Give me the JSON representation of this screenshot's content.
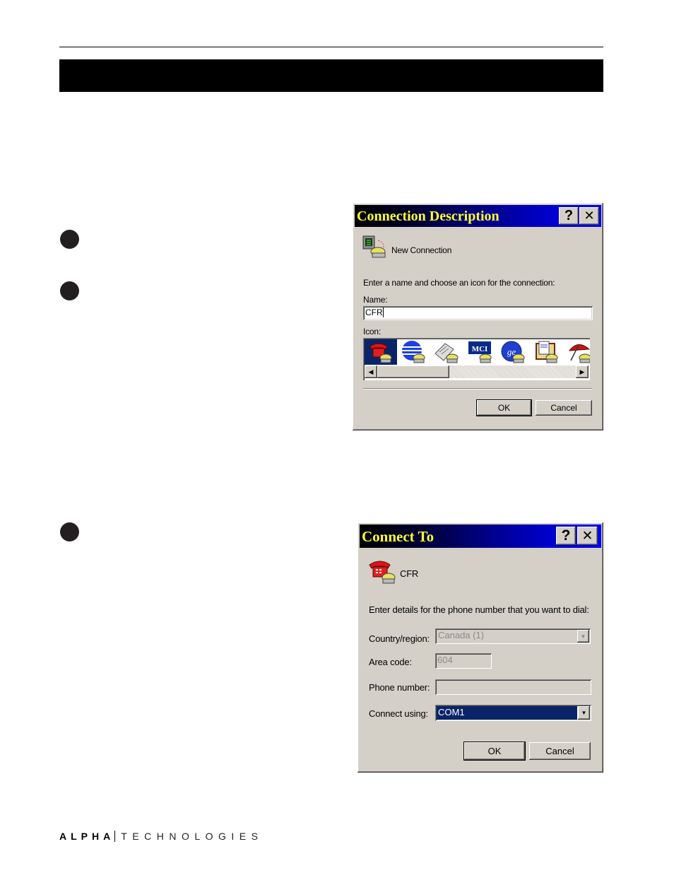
{
  "page": {
    "brand": {
      "alpha": "ALPHA",
      "technologies": "TECHNOLOGIES"
    }
  },
  "dialog1": {
    "title": "Connection Description",
    "help_button": "?",
    "close_button": "✕",
    "header_label": "New Connection",
    "instruction": "Enter a name and choose an icon for the connection:",
    "name_label": "Name:",
    "name_value": "CFR",
    "icon_label": "Icon:",
    "icons": [
      "red-telephone-icon",
      "globe-stripes-icon",
      "newspaper-icon",
      "mci-logo-icon",
      "ge-logo-icon",
      "documents-icon",
      "umbrella-icon"
    ],
    "selected_icon_index": 0,
    "ok_label": "OK",
    "cancel_label": "Cancel"
  },
  "dialog2": {
    "title": "Connect To",
    "help_button": "?",
    "close_button": "✕",
    "connection_name": "CFR",
    "instruction": "Enter details for the phone number that you want to dial:",
    "country_label": "Country/region:",
    "country_value": "Canada (1)",
    "area_code_label": "Area code:",
    "area_code_value": "604",
    "phone_label": "Phone number:",
    "phone_value": "",
    "connect_using_label": "Connect using:",
    "connect_using_value": "COM1",
    "ok_label": "OK",
    "cancel_label": "Cancel"
  },
  "colors": {
    "dialog_face": "#d4d0c8",
    "title_text": "#ffff33",
    "selection": "#0a246a"
  }
}
